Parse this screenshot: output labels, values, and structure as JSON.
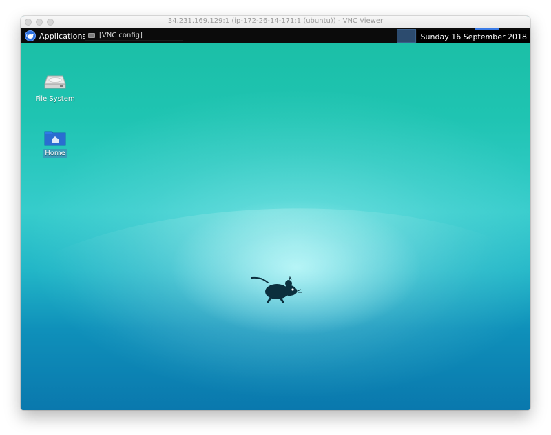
{
  "window": {
    "title": "34.231.169.129:1 (ip-172-26-14-171:1 (ubuntu)) - VNC Viewer"
  },
  "panel": {
    "applications_label": "Applications",
    "taskbar_item_label": "[VNC config]",
    "clock_text": "Sunday 16 September 2018"
  },
  "desktop": {
    "icons": [
      {
        "label": "File System",
        "icon": "drive-icon"
      },
      {
        "label": "Home",
        "icon": "home-folder-icon"
      }
    ],
    "wallpaper_mascot": "xfce-mouse-icon"
  },
  "dock": {
    "items": [
      {
        "icon": "show-desktop-icon"
      },
      {
        "icon": "terminal-icon"
      },
      {
        "icon": "home-folder-icon"
      },
      {
        "icon": "web-browser-icon"
      },
      {
        "icon": "search-icon"
      },
      {
        "icon": "folder-icon"
      }
    ]
  },
  "colors": {
    "panel_bg": "#0b0b0b",
    "desktop_top": "#1bbfa7",
    "desktop_bottom": "#0a78ad",
    "accent": "#3a7be6"
  }
}
